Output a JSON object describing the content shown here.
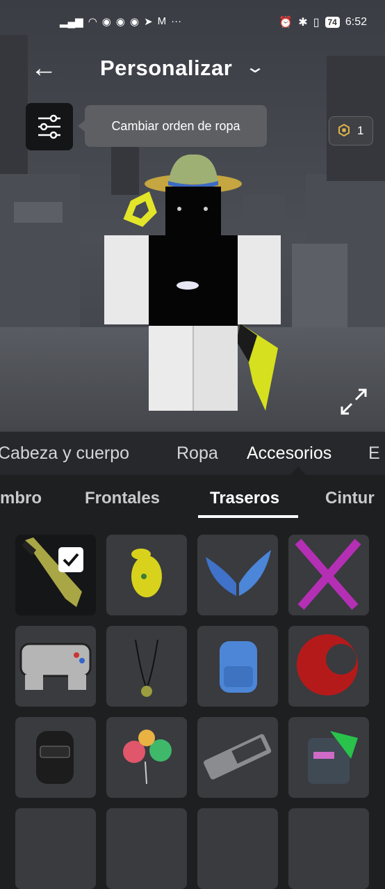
{
  "status_bar": {
    "left_icons": [
      "signal-icon",
      "wifi-icon",
      "discord-icon",
      "discord-icon",
      "discord-icon",
      "telegram-icon",
      "gmail-icon",
      "more-icon"
    ],
    "more": "···",
    "battery": "74",
    "time": "6:52"
  },
  "header": {
    "back_icon": "←",
    "title": "Personalizar",
    "dropdown_icon": "⌄"
  },
  "tooltip": {
    "text": "Cambiar orden de ropa"
  },
  "robux": {
    "count": "1"
  },
  "category_tabs": [
    {
      "label": "Cabeza y cuerpo",
      "active": false
    },
    {
      "label": "Ropa",
      "active": false
    },
    {
      "label": "Accesorios",
      "active": true
    },
    {
      "label": "E",
      "active": false
    }
  ],
  "subcategory_tabs": [
    {
      "label": "mbro",
      "active": false
    },
    {
      "label": "Frontales",
      "active": false
    },
    {
      "label": "Traseros",
      "active": true
    },
    {
      "label": "Cintur",
      "active": false
    }
  ],
  "items": [
    {
      "name": "yellow-sword-back-item",
      "selected": true
    },
    {
      "name": "yellow-frog-back-item",
      "selected": false
    },
    {
      "name": "blue-wings-back-item",
      "selected": false
    },
    {
      "name": "pink-crossed-swords-item",
      "selected": false
    },
    {
      "name": "game-controller-item",
      "selected": false
    },
    {
      "name": "medal-necklace-item",
      "selected": false
    },
    {
      "name": "nike-backpack-item",
      "selected": false
    },
    {
      "name": "red-disc-item",
      "selected": false
    },
    {
      "name": "vans-backpack-item",
      "selected": false
    },
    {
      "name": "heart-balloons-item",
      "selected": false
    },
    {
      "name": "keyboard-item",
      "selected": false
    },
    {
      "name": "robot-mask-item",
      "selected": false
    }
  ],
  "colors": {
    "accent": "#ffffff",
    "background": "#1e1f21",
    "tile": "#393b3f"
  }
}
